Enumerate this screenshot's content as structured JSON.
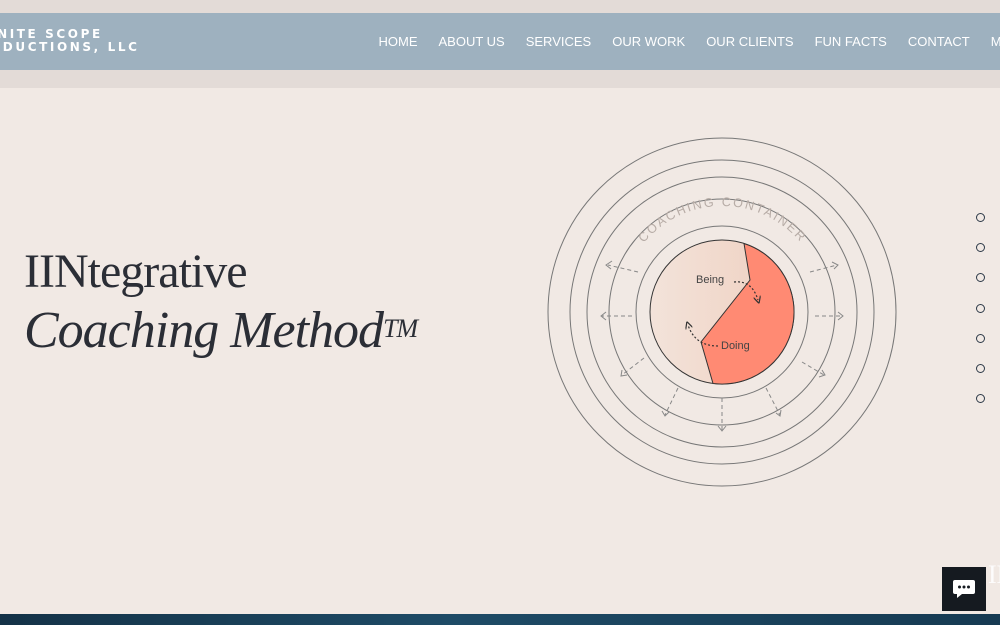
{
  "header": {
    "logo_line1": "INITE SCOPE",
    "logo_line2": "ODUCTIONS, LLC",
    "nav": [
      "HOME",
      "ABOUT US",
      "SERVICES",
      "OUR WORK",
      "OUR CLIENTS",
      "FUN FACTS",
      "CONTACT",
      "MEET T"
    ]
  },
  "hero": {
    "title_line1": "IINtegrative",
    "title_line2": "Coaching Method",
    "trademark": "TM"
  },
  "diagram": {
    "container_label": "COACHING CONTAINER",
    "being_label": "Being",
    "doing_label": "Doing"
  },
  "side_dots_count": 7,
  "colors": {
    "nav_bg": "#9eb1bf",
    "page_bg": "#f1e9e4",
    "doing_fill": "#ff8a73",
    "being_fill": "#f2d6c8",
    "chat_bg": "#151a20",
    "footer": "#1e4b66"
  },
  "chat": {
    "icon": "chat-bubble-icon"
  },
  "corner_text": "IN"
}
